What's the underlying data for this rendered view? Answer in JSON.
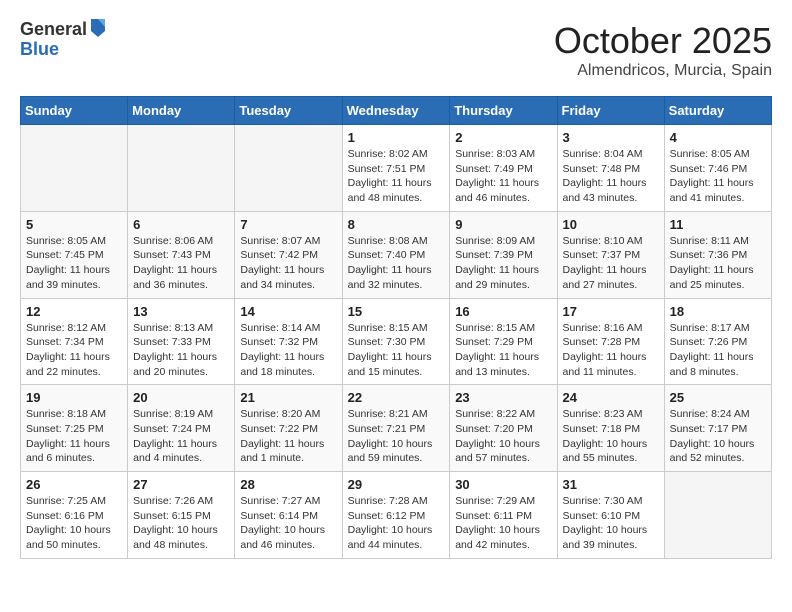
{
  "logo": {
    "general": "General",
    "blue": "Blue"
  },
  "header": {
    "month": "October 2025",
    "location": "Almendricos, Murcia, Spain"
  },
  "weekdays": [
    "Sunday",
    "Monday",
    "Tuesday",
    "Wednesday",
    "Thursday",
    "Friday",
    "Saturday"
  ],
  "weeks": [
    [
      {
        "day": "",
        "info": ""
      },
      {
        "day": "",
        "info": ""
      },
      {
        "day": "",
        "info": ""
      },
      {
        "day": "1",
        "info": "Sunrise: 8:02 AM\nSunset: 7:51 PM\nDaylight: 11 hours and 48 minutes."
      },
      {
        "day": "2",
        "info": "Sunrise: 8:03 AM\nSunset: 7:49 PM\nDaylight: 11 hours and 46 minutes."
      },
      {
        "day": "3",
        "info": "Sunrise: 8:04 AM\nSunset: 7:48 PM\nDaylight: 11 hours and 43 minutes."
      },
      {
        "day": "4",
        "info": "Sunrise: 8:05 AM\nSunset: 7:46 PM\nDaylight: 11 hours and 41 minutes."
      }
    ],
    [
      {
        "day": "5",
        "info": "Sunrise: 8:05 AM\nSunset: 7:45 PM\nDaylight: 11 hours and 39 minutes."
      },
      {
        "day": "6",
        "info": "Sunrise: 8:06 AM\nSunset: 7:43 PM\nDaylight: 11 hours and 36 minutes."
      },
      {
        "day": "7",
        "info": "Sunrise: 8:07 AM\nSunset: 7:42 PM\nDaylight: 11 hours and 34 minutes."
      },
      {
        "day": "8",
        "info": "Sunrise: 8:08 AM\nSunset: 7:40 PM\nDaylight: 11 hours and 32 minutes."
      },
      {
        "day": "9",
        "info": "Sunrise: 8:09 AM\nSunset: 7:39 PM\nDaylight: 11 hours and 29 minutes."
      },
      {
        "day": "10",
        "info": "Sunrise: 8:10 AM\nSunset: 7:37 PM\nDaylight: 11 hours and 27 minutes."
      },
      {
        "day": "11",
        "info": "Sunrise: 8:11 AM\nSunset: 7:36 PM\nDaylight: 11 hours and 25 minutes."
      }
    ],
    [
      {
        "day": "12",
        "info": "Sunrise: 8:12 AM\nSunset: 7:34 PM\nDaylight: 11 hours and 22 minutes."
      },
      {
        "day": "13",
        "info": "Sunrise: 8:13 AM\nSunset: 7:33 PM\nDaylight: 11 hours and 20 minutes."
      },
      {
        "day": "14",
        "info": "Sunrise: 8:14 AM\nSunset: 7:32 PM\nDaylight: 11 hours and 18 minutes."
      },
      {
        "day": "15",
        "info": "Sunrise: 8:15 AM\nSunset: 7:30 PM\nDaylight: 11 hours and 15 minutes."
      },
      {
        "day": "16",
        "info": "Sunrise: 8:15 AM\nSunset: 7:29 PM\nDaylight: 11 hours and 13 minutes."
      },
      {
        "day": "17",
        "info": "Sunrise: 8:16 AM\nSunset: 7:28 PM\nDaylight: 11 hours and 11 minutes."
      },
      {
        "day": "18",
        "info": "Sunrise: 8:17 AM\nSunset: 7:26 PM\nDaylight: 11 hours and 8 minutes."
      }
    ],
    [
      {
        "day": "19",
        "info": "Sunrise: 8:18 AM\nSunset: 7:25 PM\nDaylight: 11 hours and 6 minutes."
      },
      {
        "day": "20",
        "info": "Sunrise: 8:19 AM\nSunset: 7:24 PM\nDaylight: 11 hours and 4 minutes."
      },
      {
        "day": "21",
        "info": "Sunrise: 8:20 AM\nSunset: 7:22 PM\nDaylight: 11 hours and 1 minute."
      },
      {
        "day": "22",
        "info": "Sunrise: 8:21 AM\nSunset: 7:21 PM\nDaylight: 10 hours and 59 minutes."
      },
      {
        "day": "23",
        "info": "Sunrise: 8:22 AM\nSunset: 7:20 PM\nDaylight: 10 hours and 57 minutes."
      },
      {
        "day": "24",
        "info": "Sunrise: 8:23 AM\nSunset: 7:18 PM\nDaylight: 10 hours and 55 minutes."
      },
      {
        "day": "25",
        "info": "Sunrise: 8:24 AM\nSunset: 7:17 PM\nDaylight: 10 hours and 52 minutes."
      }
    ],
    [
      {
        "day": "26",
        "info": "Sunrise: 7:25 AM\nSunset: 6:16 PM\nDaylight: 10 hours and 50 minutes."
      },
      {
        "day": "27",
        "info": "Sunrise: 7:26 AM\nSunset: 6:15 PM\nDaylight: 10 hours and 48 minutes."
      },
      {
        "day": "28",
        "info": "Sunrise: 7:27 AM\nSunset: 6:14 PM\nDaylight: 10 hours and 46 minutes."
      },
      {
        "day": "29",
        "info": "Sunrise: 7:28 AM\nSunset: 6:12 PM\nDaylight: 10 hours and 44 minutes."
      },
      {
        "day": "30",
        "info": "Sunrise: 7:29 AM\nSunset: 6:11 PM\nDaylight: 10 hours and 42 minutes."
      },
      {
        "day": "31",
        "info": "Sunrise: 7:30 AM\nSunset: 6:10 PM\nDaylight: 10 hours and 39 minutes."
      },
      {
        "day": "",
        "info": ""
      }
    ]
  ]
}
